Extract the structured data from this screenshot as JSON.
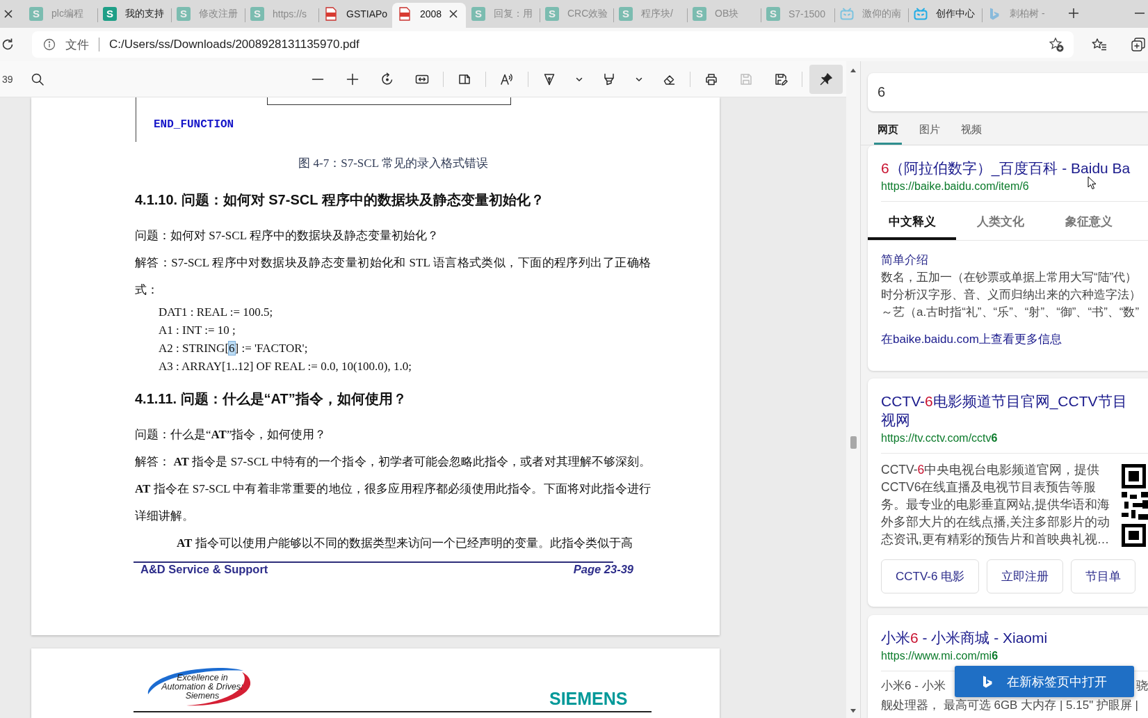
{
  "tabs": [
    {
      "label": "plc编程",
      "kind": "letter",
      "icon_text": "S",
      "sleeping": true,
      "selected": false
    },
    {
      "label": "我的支持",
      "kind": "letter",
      "icon_text": "S",
      "sleeping": false,
      "selected": false
    },
    {
      "label": "修改注册",
      "kind": "letter",
      "icon_text": "S",
      "sleeping": true,
      "selected": false
    },
    {
      "label": "https://s",
      "kind": "letter",
      "icon_text": "S",
      "sleeping": true,
      "selected": false
    },
    {
      "label": "GSTIAPo",
      "kind": "pdf",
      "sleeping": false,
      "selected": false
    },
    {
      "label": "2008",
      "kind": "pdf",
      "sleeping": false,
      "selected": true
    },
    {
      "label": "回复：用",
      "kind": "letter",
      "icon_text": "S",
      "sleeping": true,
      "selected": false
    },
    {
      "label": "CRC效验",
      "kind": "letter",
      "icon_text": "S",
      "sleeping": true,
      "selected": false
    },
    {
      "label": "程序块/",
      "kind": "letter",
      "icon_text": "S",
      "sleeping": true,
      "selected": false
    },
    {
      "label": "OB块",
      "kind": "letter",
      "icon_text": "S",
      "sleeping": true,
      "selected": false
    },
    {
      "label": "S7-1500",
      "kind": "letter",
      "icon_text": "S",
      "sleeping": true,
      "selected": false
    },
    {
      "label": "激仰的南",
      "kind": "tv",
      "sleeping": true,
      "selected": false
    },
    {
      "label": "创作中心",
      "kind": "tv",
      "sleeping": false,
      "selected": false
    },
    {
      "label": "刺柏树 -",
      "kind": "b-logo",
      "sleeping": true,
      "selected": false
    }
  ],
  "address_bar": {
    "site_label": "文件",
    "url": "C:/Users/ss/Downloads/2008928131135970.pdf"
  },
  "pdf_toolbar": {
    "page_number": "39",
    "groups": [
      [
        {
          "kind": "search",
          "disabled": false,
          "pressed": false
        }
      ],
      [
        {
          "kind": "zoom-out",
          "disabled": false,
          "pressed": false
        },
        {
          "kind": "zoom-in",
          "disabled": false,
          "pressed": false
        },
        {
          "kind": "rotate",
          "disabled": false,
          "pressed": false
        },
        {
          "kind": "fit-width",
          "disabled": false,
          "pressed": false
        }
      ],
      [
        {
          "kind": "page-view",
          "disabled": false,
          "pressed": false
        }
      ],
      [
        {
          "kind": "read-aloud",
          "disabled": false,
          "pressed": false
        }
      ],
      [
        {
          "kind": "draw",
          "disabled": false,
          "pressed": false
        },
        {
          "kind": "dropdown",
          "disabled": false,
          "pressed": false
        },
        {
          "kind": "highlight",
          "disabled": false,
          "pressed": false
        },
        {
          "kind": "dropdown",
          "disabled": false,
          "pressed": false
        },
        {
          "kind": "erase",
          "disabled": false,
          "pressed": false
        }
      ],
      [
        {
          "kind": "print",
          "disabled": false,
          "pressed": false
        },
        {
          "kind": "save",
          "disabled": true,
          "pressed": false
        },
        {
          "kind": "save-as",
          "disabled": false,
          "pressed": false
        }
      ],
      [
        {
          "kind": "pin",
          "disabled": false,
          "pressed": true
        }
      ]
    ]
  },
  "pdf_page": {
    "figure_code": "END_FUNCTION",
    "caption": "图 4-7：S7-SCL 常见的录入格式错误",
    "sections": [
      {
        "heading": "4.1.10. 问题：如何对 S7-SCL 程序中的数据块及静态变量初始化？",
        "blocks": [
          {
            "kind": "paragraph",
            "text": "问题：如何对 S7-SCL 程序中的数据块及静态变量初始化？",
            "indented": false
          },
          {
            "kind": "paragraph",
            "text": "解答：S7-SCL 程序中对数据块及静态变量初始化和 STL 语言格式类似，下面的程序列出了正确格式：",
            "indented": false
          },
          {
            "kind": "code",
            "lines": [
              {
                "segments": [
                  {
                    "text": "DAT1 : REAL := 100.5;",
                    "highlighted": false
                  }
                ]
              },
              {
                "segments": [
                  {
                    "text": "A1 : INT := 10 ;",
                    "highlighted": false
                  }
                ]
              },
              {
                "segments": [
                  {
                    "text": "A2 : STRING[",
                    "highlighted": false
                  },
                  {
                    "text": "6",
                    "highlighted": true
                  },
                  {
                    "text": "] := 'FACTOR';",
                    "highlighted": false
                  }
                ]
              },
              {
                "segments": [
                  {
                    "text": "A3 : ARRAY[1..12] OF REAL := 0.0, 10(100.0), 1.0;",
                    "highlighted": false
                  }
                ]
              }
            ]
          }
        ]
      },
      {
        "heading": "4.1.11. 问题：什么是“AT”指令，如何使用？",
        "blocks": [
          {
            "kind": "paragraph",
            "text": "问题：什么是“**AT**”指令，如何使用？",
            "indented": false
          },
          {
            "kind": "paragraph",
            "text": "解答： **AT** 指令是 S7-SCL 中特有的一个指令，初学者可能会忽略此指令，或者对其理解不够深刻。**AT** 指令在 S7-SCL 中有着非常重要的地位，很多应用程序都必须使用此指令。下面将对此指令进行详细讲解。",
            "indented": false
          },
          {
            "kind": "paragraph",
            "text": "**AT** 指令可以使用户能够以不同的数据类型来访问一个已经声明的变量。此指令类似于高",
            "indented": true
          }
        ]
      }
    ],
    "footer": {
      "left": "A&D Service & Support",
      "right": "Page 23-39"
    }
  },
  "next_page": {
    "logo_lines": [
      "Excellence in",
      "Automation & Drives:",
      "Siemens"
    ],
    "brand": "SIEMENS"
  },
  "sidebar": {
    "search": {
      "value": "6"
    },
    "tabs": [
      {
        "label": "网页",
        "selected": true
      },
      {
        "label": "图片",
        "selected": false
      },
      {
        "label": "视频",
        "selected": false
      }
    ],
    "results": [
      {
        "kind": "encyclopedia",
        "title_lines": [
          [
            {
              "text": "6",
              "match": true
            },
            {
              "text": "（阿拉伯数字）_百度百科 - Baidu Ba",
              "match": false
            }
          ]
        ],
        "url": "https://baike.baidu.com/item/6",
        "tabs": [
          {
            "label": "中文释义",
            "selected": true
          },
          {
            "label": "人类文化",
            "selected": false
          },
          {
            "label": "象征意义",
            "selected": false
          }
        ],
        "section_title": "简单介绍",
        "lines": [
          "数名，五加一（在钞票或单据上常用大写“陆”代）",
          "时分析汉字形、音、义而归纳出来的六种造字法）",
          "～艺（a.古时指“礼”、“乐”、“射”、“御”、“书”、“数”"
        ],
        "more_link": "在baike.baidu.com上查看更多信息"
      },
      {
        "kind": "site",
        "title_lines": [
          [
            {
              "text": "CCTV-",
              "match": false
            },
            {
              "text": "6",
              "match": true
            },
            {
              "text": "电影频道节目官网_CCTV节目",
              "match": false
            }
          ],
          [
            {
              "text": "视网",
              "match": false
            }
          ]
        ],
        "url": "https://tv.cctv.com/cctv**6**",
        "snippet": [
          {
            "text": "CCTV-",
            "match": false
          },
          {
            "text": "6",
            "match": true
          },
          {
            "text": "中央电视台电影频道官网，提供CCTV6在线直播及电视节目表预告等服务。最专业的电影垂直网站,提供华语和海外多部大片的在线点播,关注多部影片的动态资讯,更有精彩的预告片和首映典礼视…",
            "match": false
          }
        ],
        "buttons": [
          "CCTV-6 电影",
          "立即注册",
          "节目单"
        ]
      },
      {
        "kind": "product",
        "title_lines": [
          [
            {
              "text": "小米",
              "match": false
            },
            {
              "text": "6",
              "match": true
            },
            {
              "text": " - 小米商城 - Xiaomi",
              "match": false
            }
          ]
        ],
        "url": "https://www.mi.com/mi**6**",
        "snippet_lines": [
          [
            "小米6 - 小米",
            "骁"
          ],
          [
            "舰处理器， 最高可选 6GB 大内存 | 5.15\" 护眼屏 |"
          ]
        ]
      }
    ],
    "open_button": "在新标签页中打开"
  }
}
